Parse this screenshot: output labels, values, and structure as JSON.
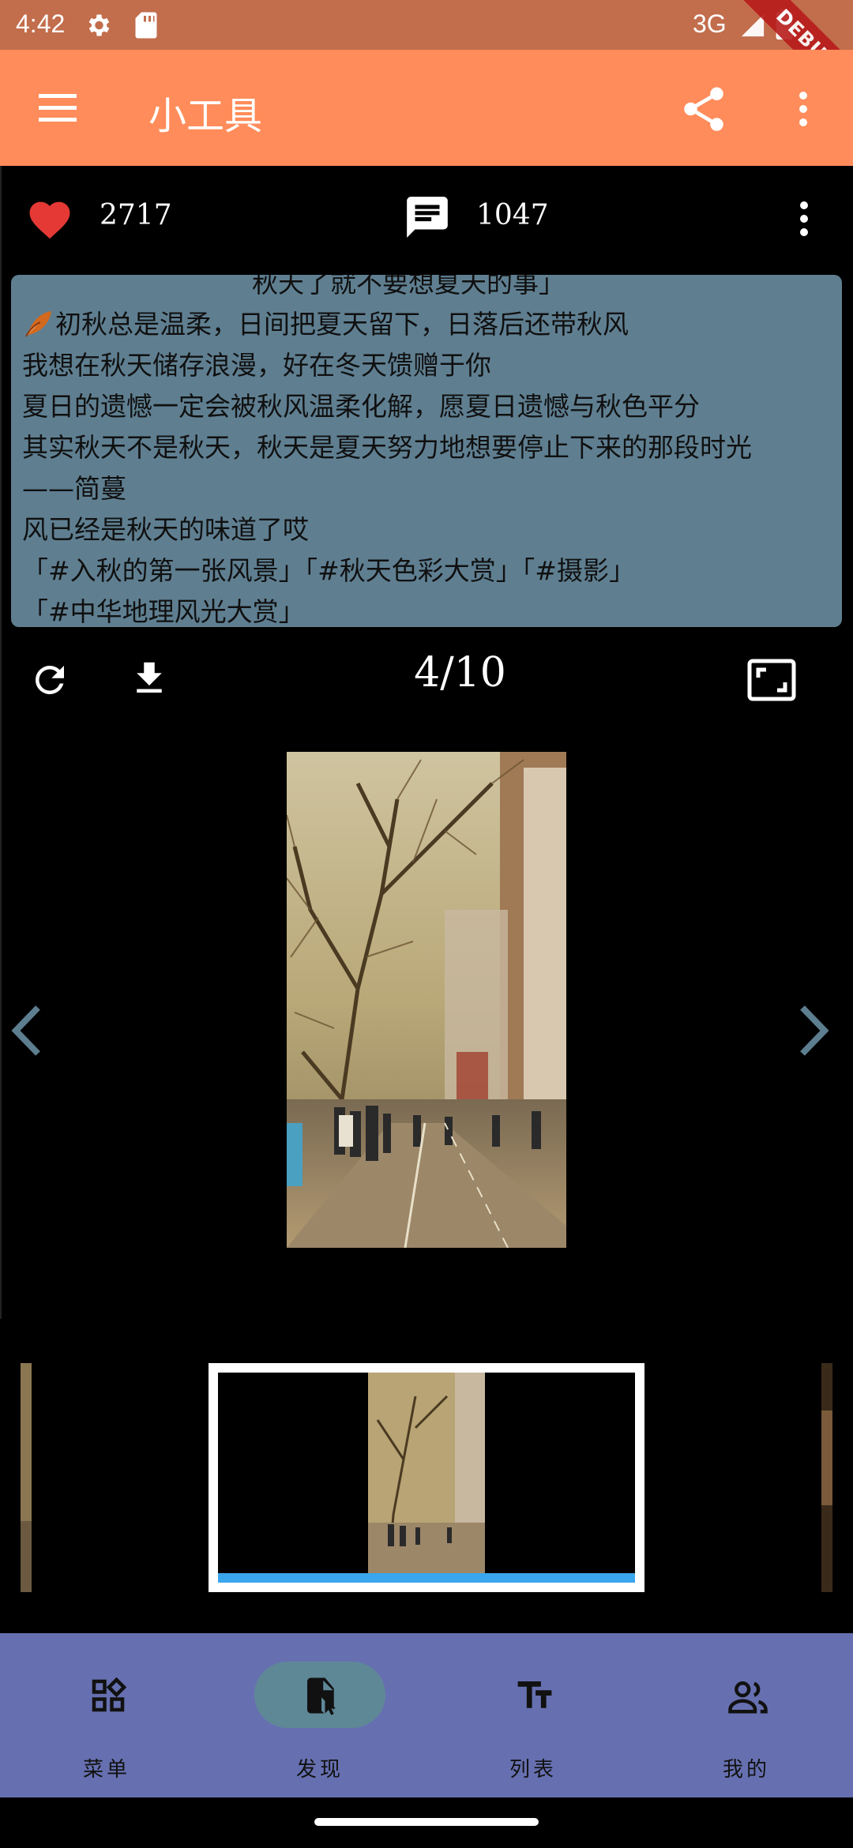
{
  "status_bar": {
    "time": "4:42",
    "network": "3G",
    "debug_label": "DEBUG"
  },
  "app_bar": {
    "title": "小工具",
    "bg_color": "#ff8c5a"
  },
  "stats": {
    "likes": "2717",
    "comments": "1047",
    "like_color": "#e53935"
  },
  "description": {
    "cut_top_line": "秋天了就不要想夏天的事」",
    "lines": [
      "初秋总是温柔，日间把夏天留下，日落后还带秋风",
      "我想在秋天储存浪漫，好在冬天馈赠于你",
      "夏日的遗憾一定会被秋风温柔化解，愿夏日遗憾与秋色平分",
      "其实秋天不是秋天，秋天是夏天努力地想要停止下来的那段时光",
      "——简蔓",
      "风已经是秋天的味道了哎",
      "「#入秋的第一张风景」「#秋天色彩大赏」「#摄影」",
      "「#中华地理风光大赏」"
    ],
    "card_color": "#5f7f91"
  },
  "viewer": {
    "page_indicator": "4/10",
    "current_page": 4,
    "total_pages": 10
  },
  "bottom_nav": {
    "items": [
      {
        "label": "菜单",
        "icon": "widgets-icon",
        "selected": false
      },
      {
        "label": "发现",
        "icon": "document-pointer-icon",
        "selected": true
      },
      {
        "label": "列表",
        "icon": "text-fields-icon",
        "selected": false
      },
      {
        "label": "我的",
        "icon": "people-icon",
        "selected": false
      }
    ],
    "bg_color": "#6670b0",
    "selected_pill_color": "#5f8897"
  },
  "thumbnail_strip": {
    "selected_bar_color": "#3aa6ee"
  }
}
